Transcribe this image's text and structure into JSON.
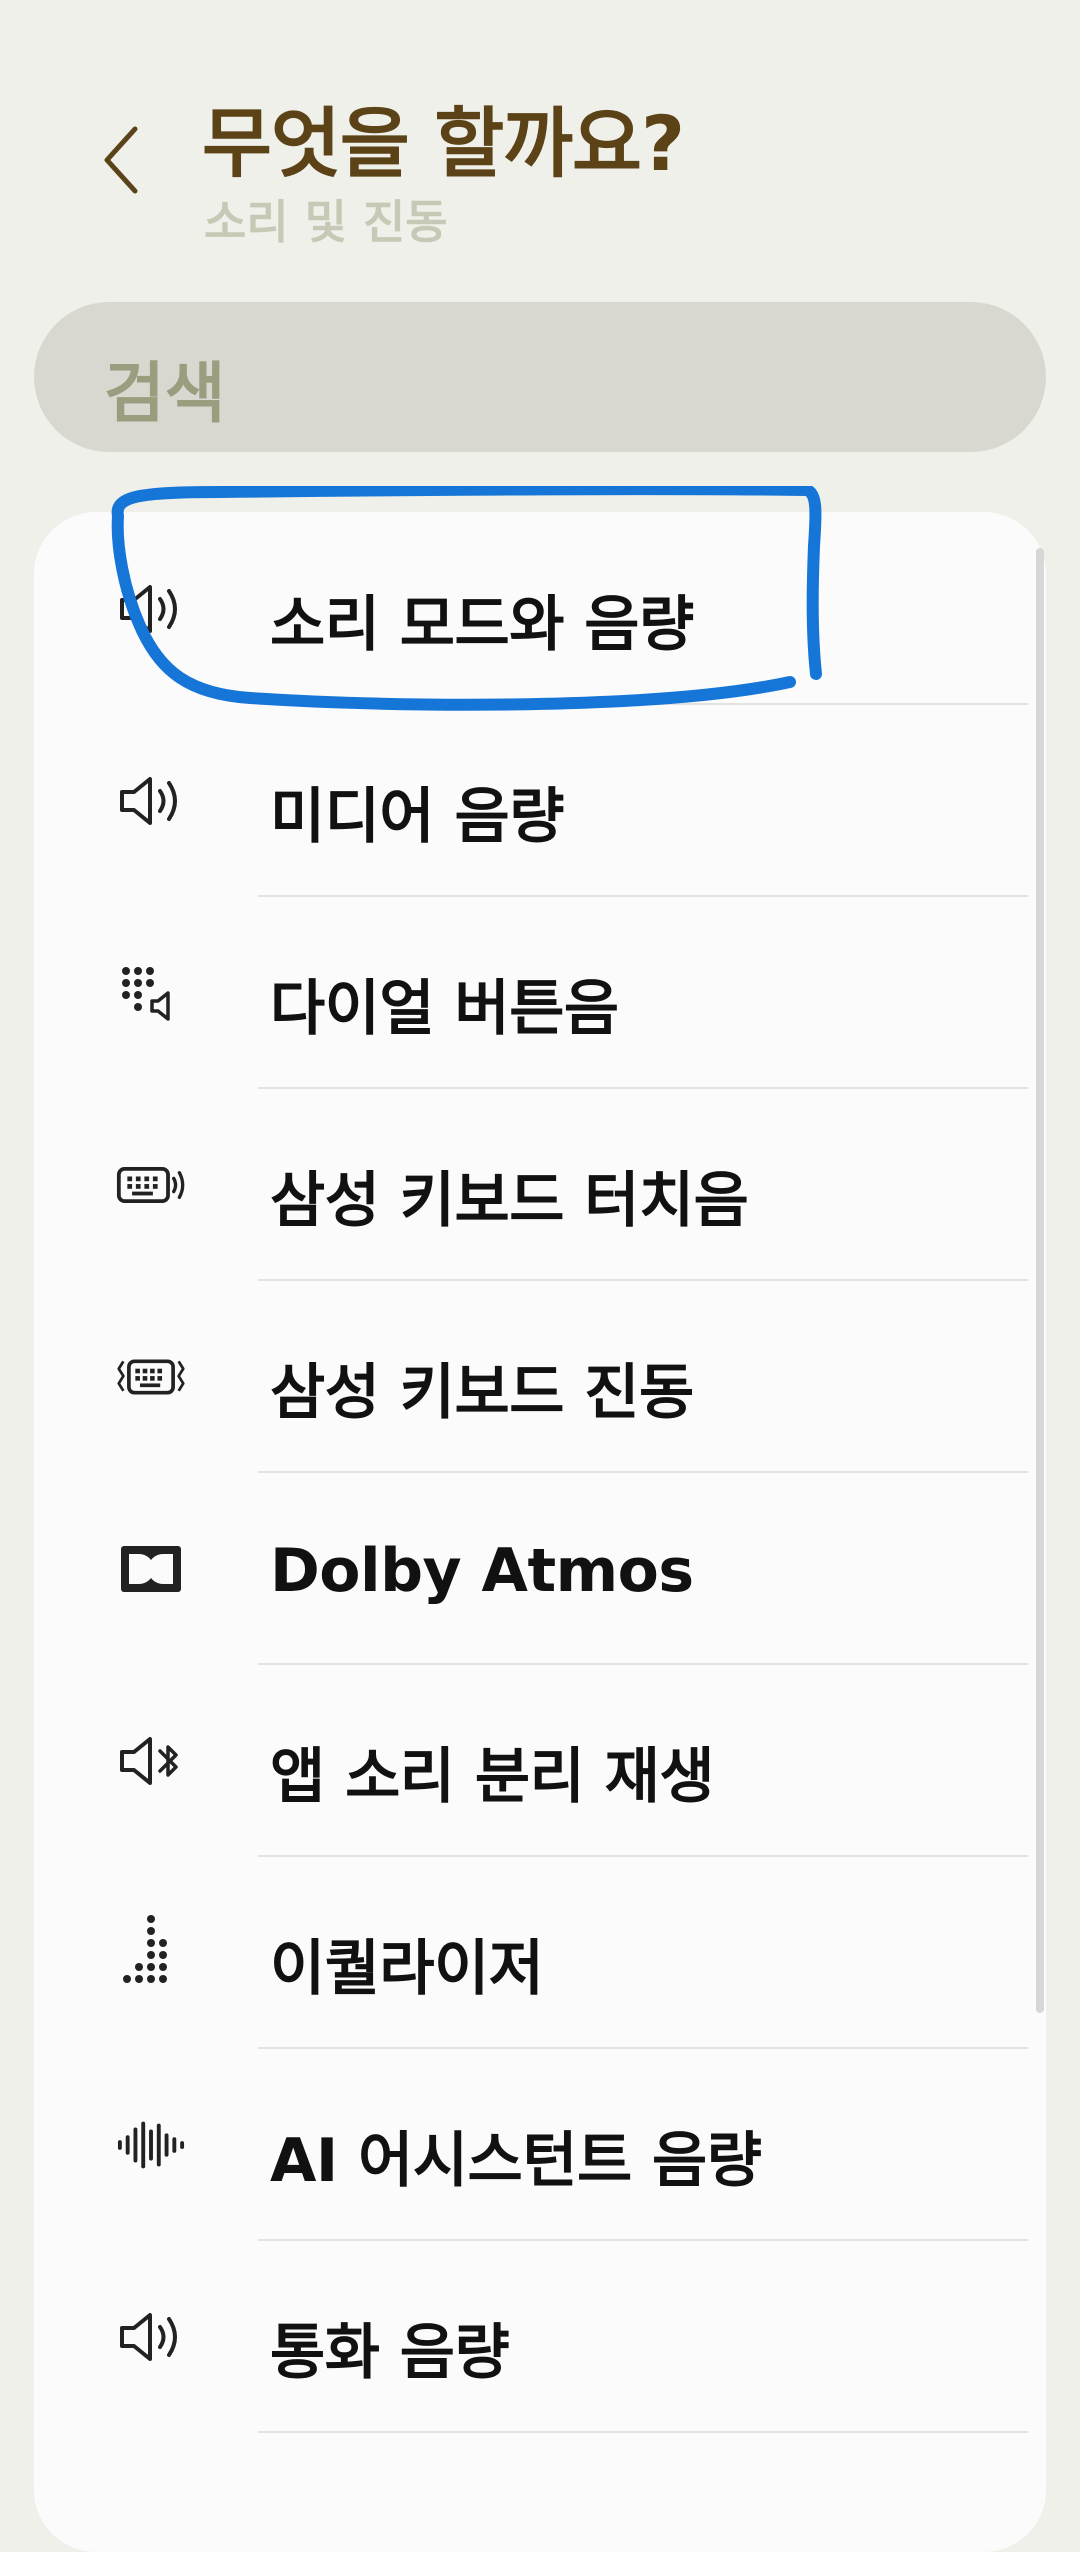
{
  "header": {
    "title": "무엇을 할까요?",
    "subtitle": "소리 및 진동"
  },
  "search": {
    "placeholder": "검색"
  },
  "items": [
    {
      "label": "소리 모드와 음량",
      "icon": "speaker-icon"
    },
    {
      "label": "미디어 음량",
      "icon": "speaker-icon"
    },
    {
      "label": "다이얼 버튼음",
      "icon": "dialpad-sound-icon"
    },
    {
      "label": "삼성 키보드 터치음",
      "icon": "keyboard-sound-icon"
    },
    {
      "label": "삼성 키보드 진동",
      "icon": "keyboard-vibration-icon"
    },
    {
      "label": "Dolby Atmos",
      "icon": "dolby-icon"
    },
    {
      "label": "앱 소리 분리 재생",
      "icon": "speaker-bluetooth-icon"
    },
    {
      "label": "이퀄라이저",
      "icon": "equalizer-icon"
    },
    {
      "label": "AI 어시스턴트 음량",
      "icon": "sound-wave-icon"
    },
    {
      "label": "통화 음량",
      "icon": "speaker-icon"
    }
  ],
  "colors": {
    "background": "#f0f0ea",
    "title": "#5c4317",
    "subtitle": "#c7c9b6",
    "search_bg": "#d8d8d1",
    "search_text": "#9c9d7f",
    "highlight_stroke": "#1676d8"
  }
}
